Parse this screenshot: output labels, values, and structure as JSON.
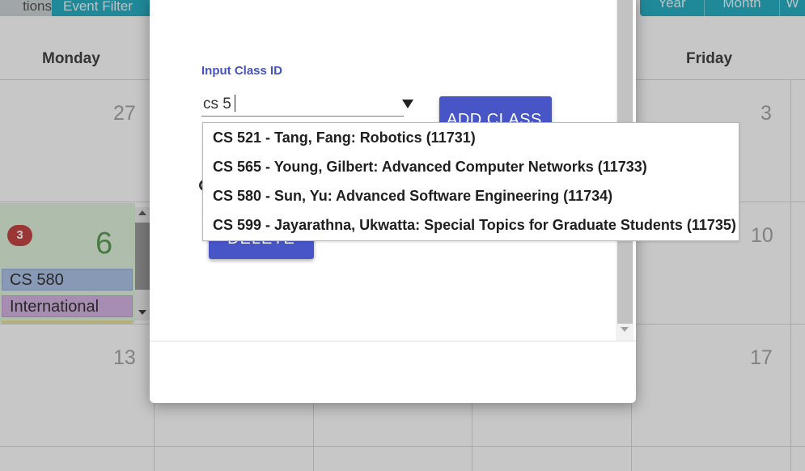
{
  "calendar": {
    "top_tabs": {
      "left_tab": "tions",
      "event_filter": "Event Filter"
    },
    "view_buttons": {
      "year": "Year",
      "month": "Month",
      "extra": "W"
    },
    "day_headers": {
      "monday": "Monday",
      "friday": "Friday"
    },
    "dates": {
      "d27": "27",
      "d3": "3",
      "d10": "10",
      "d13": "13",
      "d17": "17"
    },
    "today": {
      "date": "6",
      "event_count": "3",
      "events": [
        "CS 580",
        "International"
      ]
    },
    "colors": {
      "tab_teal": "#2ab0c5",
      "today_bg": "#e1f3dd",
      "badge_red": "#c74646",
      "event_blue": "#afc4e8",
      "event_purple": "#d7b5e3"
    }
  },
  "modal": {
    "field_label": "Input Class ID",
    "class_input_value": "cs 5",
    "add_class_label": "ADD CLASS",
    "delete_label": "DELETE",
    "primary_color": "#4755c7",
    "label_color": "#4653bd",
    "suggestions": [
      "CS 521 - Tang, Fang: Robotics (11731)",
      "CS 565 - Young, Gilbert: Advanced Computer Networks (11733)",
      "CS 580 - Sun, Yu: Advanced Software Engineering (11734)",
      "CS 599 - Jayarathna, Ukwatta: Special Topics for Graduate Students (11735)"
    ]
  },
  "icons": {
    "dropdown": "triangle-down-icon",
    "scroll_up": "arrow-up-icon",
    "scroll_down": "arrow-down-icon"
  }
}
